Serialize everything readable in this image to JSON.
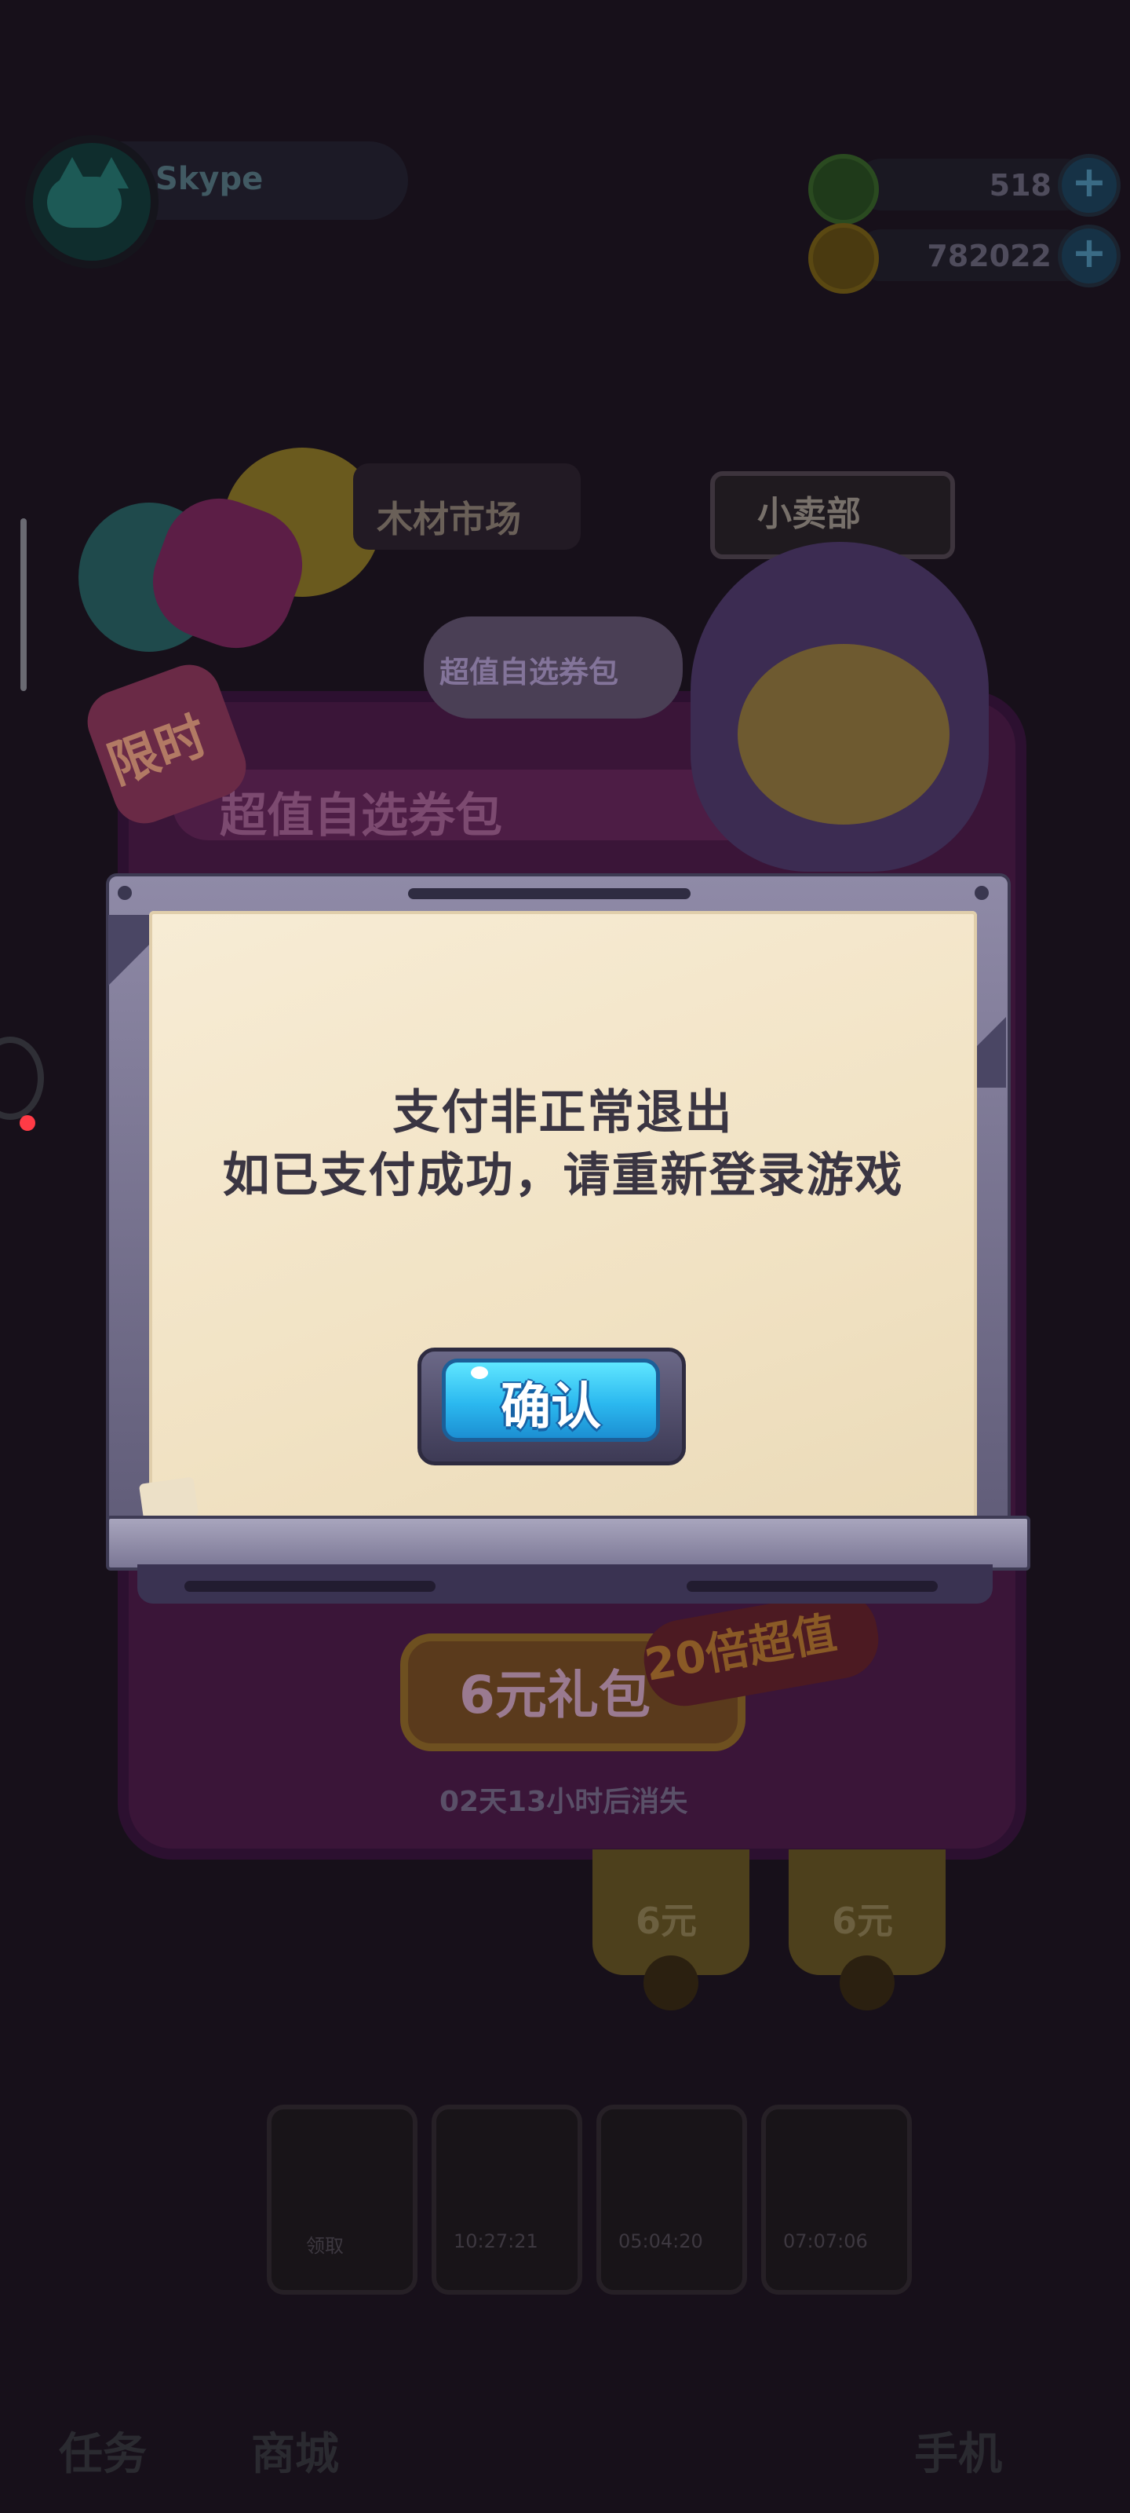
{
  "hud": {
    "player_name": "Skype",
    "currency_green": "518",
    "currency_gold": "782022",
    "plus_label": "+"
  },
  "background": {
    "pack_banner": "超值自选券包",
    "pack_title": "超值自选券包",
    "limited_badge": "限时",
    "store_left": "木材市场",
    "store_right": "小卖部",
    "gift_button": "6元礼包",
    "multiplier_ribbon": "20倍超值",
    "countdown": "02天13小时后消失",
    "price_tags": [
      "6元",
      "6元"
    ],
    "card_timers": [
      "10:27:21",
      "05:04:20",
      "07:07:06"
    ],
    "card_label": "领取",
    "nav": {
      "tasks": "任务",
      "shop": "商城",
      "phone": "手机"
    }
  },
  "dialog": {
    "message_line1": "支付非正常退出",
    "message_line2": "如已支付成功，请重新登录游戏",
    "confirm_label": "确认"
  },
  "colors": {
    "overlay_dim": "#0a0708",
    "paper": "#f3e6ca",
    "frame": "#7d7997",
    "button_blue": "#2bb8ef",
    "notification_dot": "#ff3b46"
  }
}
